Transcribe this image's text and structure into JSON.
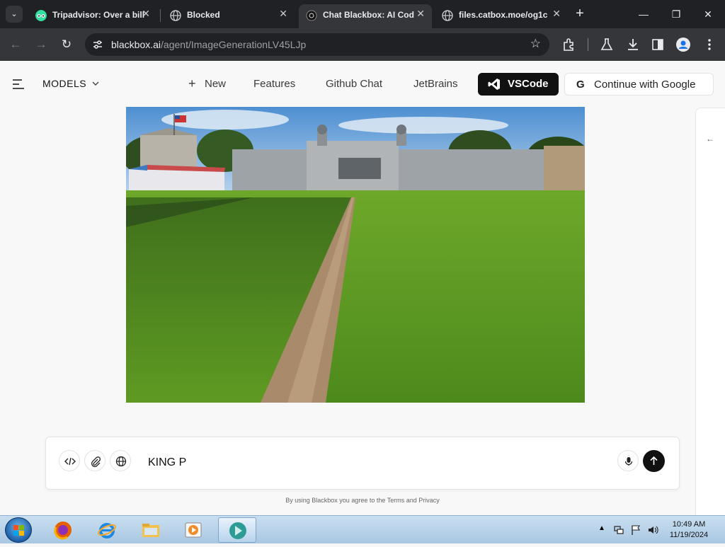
{
  "browser": {
    "tabs": [
      {
        "title": "Tripadvisor: Over a bill",
        "active": false
      },
      {
        "title": "Blocked",
        "active": false
      },
      {
        "title": "Chat Blackbox: AI Cod",
        "active": true
      },
      {
        "title": "files.catbox.moe/og1c",
        "active": false
      }
    ],
    "new_tab_symbol": "+",
    "close_symbol": "✕",
    "url_domain": "blackbox.ai",
    "url_path": "/agent/ImageGenerationLV45LJp"
  },
  "header": {
    "models_label": "MODELS",
    "nav": {
      "new_label": "New",
      "features_label": "Features",
      "github_chat_label": "Github Chat",
      "jetbrains_label": "JetBrains",
      "vscode_label": "VSCode",
      "google_label": "Continue with Google",
      "google_g": "G"
    }
  },
  "side_panel": {
    "toggle_symbol": "←"
  },
  "chat": {
    "input_value": "KING P",
    "terms_text": "By using Blackbox you agree to the Terms and Privacy"
  },
  "taskbar": {
    "time": "10:49 AM",
    "date": "11/19/2024"
  },
  "colors": {
    "chrome_dark": "#202124",
    "chrome_toolbar": "#35363a",
    "vscode_button": "#111111",
    "send_button": "#111111"
  }
}
